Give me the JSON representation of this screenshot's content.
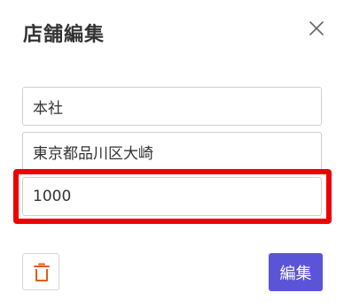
{
  "dialog": {
    "title": "店舗編集",
    "close_icon": "close-icon"
  },
  "form": {
    "store_name": "本社",
    "address": "東京都品川区大崎",
    "number": "1000"
  },
  "actions": {
    "delete_icon": "trash-icon",
    "edit_label": "編集"
  },
  "colors": {
    "primary": "#5b54d6",
    "danger_icon": "#e25c12",
    "highlight": "#ee0000"
  }
}
